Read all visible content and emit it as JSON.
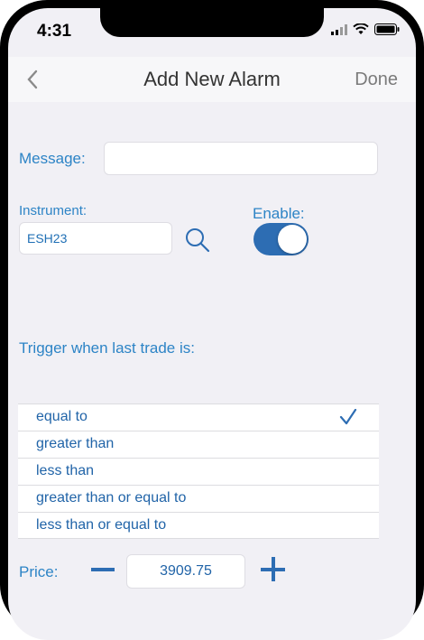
{
  "status": {
    "time": "4:31"
  },
  "nav": {
    "title": "Add New Alarm",
    "done_label": "Done"
  },
  "form": {
    "message_label": "Message:",
    "message_value": "",
    "instrument_label": "Instrument:",
    "instrument_value": "ESH23",
    "enable_label": "Enable:",
    "enable_on": true,
    "trigger_label": "Trigger when last trade is:",
    "options": [
      {
        "label": "equal to",
        "selected": true
      },
      {
        "label": "greater than",
        "selected": false
      },
      {
        "label": "less than",
        "selected": false
      },
      {
        "label": "greater than or equal to",
        "selected": false
      },
      {
        "label": "less than or equal to",
        "selected": false
      }
    ],
    "price_label": "Price:",
    "price_value": "3909.75"
  },
  "colors": {
    "accent": "#2d6db3",
    "label_blue": "#2d84c6",
    "background": "#f1f0f5"
  }
}
